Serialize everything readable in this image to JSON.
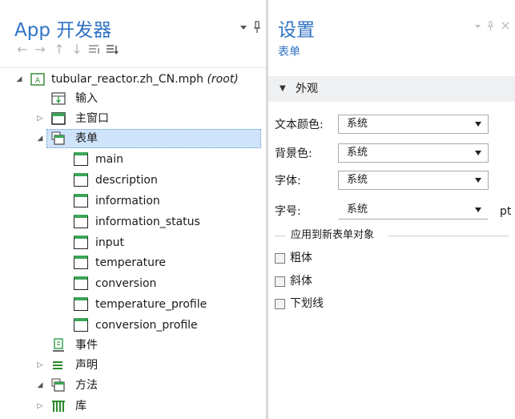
{
  "left_panel": {
    "title": "App 开发器",
    "tree": [
      {
        "label": "tubular_reactor.zh_CN.mph",
        "suffix": "(root)",
        "icon": "app-root-icon",
        "twisty": "expanded"
      },
      {
        "label": "输入",
        "icon": "input-declaration-icon",
        "twisty": "none"
      },
      {
        "label": "主窗口",
        "icon": "main-window-icon",
        "twisty": "collapsed"
      },
      {
        "label": "表单",
        "icon": "forms-icon",
        "twisty": "expanded",
        "selected": true
      },
      {
        "label": "main",
        "icon": "form-icon"
      },
      {
        "label": "description",
        "icon": "form-icon"
      },
      {
        "label": "information",
        "icon": "form-icon"
      },
      {
        "label": "information_status",
        "icon": "form-icon"
      },
      {
        "label": "input",
        "icon": "form-icon"
      },
      {
        "label": "temperature",
        "icon": "form-icon"
      },
      {
        "label": "conversion",
        "icon": "form-icon"
      },
      {
        "label": "temperature_profile",
        "icon": "form-icon"
      },
      {
        "label": "conversion_profile",
        "icon": "form-icon"
      },
      {
        "label": "事件",
        "icon": "events-icon",
        "twisty": "none"
      },
      {
        "label": "声明",
        "icon": "declarations-icon",
        "twisty": "collapsed"
      },
      {
        "label": "方法",
        "icon": "methods-icon",
        "twisty": "expanded"
      },
      {
        "label": "库",
        "icon": "libraries-icon",
        "twisty": "collapsed"
      }
    ]
  },
  "right_panel": {
    "title": "设置",
    "subtitle": "表单",
    "section": "外观",
    "props": {
      "text_color_label": "文本颜色:",
      "text_color_value": "系统",
      "bg_color_label": "背景色:",
      "bg_color_value": "系统",
      "font_label": "字体:",
      "font_value": "系统",
      "size_label": "字号:",
      "size_value": "系统",
      "size_unit": "pt"
    },
    "group_label": "应用到新表单对象",
    "checkboxes": [
      {
        "label": "粗体",
        "checked": false
      },
      {
        "label": "斜体",
        "checked": false
      },
      {
        "label": "下划线",
        "checked": false
      }
    ]
  },
  "colors": {
    "accent": "#2f73c5",
    "selection": "#cfe3fa",
    "form_icon_top": "#3aa655"
  }
}
